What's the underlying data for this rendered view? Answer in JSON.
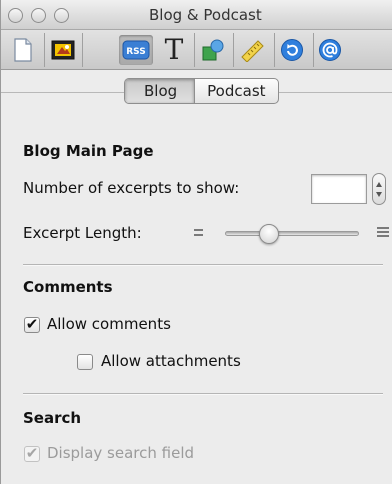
{
  "window": {
    "title": "Blog & Podcast"
  },
  "toolbar": {
    "buttons": [
      {
        "name": "document-icon"
      },
      {
        "name": "media-icon"
      },
      {
        "name": "rss-icon",
        "label": "RSS",
        "selected": true
      },
      {
        "name": "text-icon",
        "label": "T"
      },
      {
        "name": "shapes-icon"
      },
      {
        "name": "ruler-icon"
      },
      {
        "name": "refresh-icon"
      },
      {
        "name": "at-icon"
      }
    ]
  },
  "tabs": {
    "blog": "Blog",
    "podcast": "Podcast",
    "selected": "Blog"
  },
  "blog_main_page": {
    "heading": "Blog Main Page",
    "excerpts_label": "Number of excerpts to show:",
    "excerpts_value": "",
    "excerpt_length_label": "Excerpt Length:",
    "excerpt_length_level": 0.3
  },
  "comments": {
    "heading": "Comments",
    "allow_comments_label": "Allow comments",
    "allow_comments_checked": true,
    "allow_attachments_label": "Allow attachments",
    "allow_attachments_checked": false
  },
  "search": {
    "heading": "Search",
    "display_search_field_label": "Display search field",
    "display_search_field_checked": true,
    "display_search_field_enabled": false
  },
  "colors": {
    "rss_blue": "#3b7fd4",
    "window_bg": "#ececec"
  }
}
